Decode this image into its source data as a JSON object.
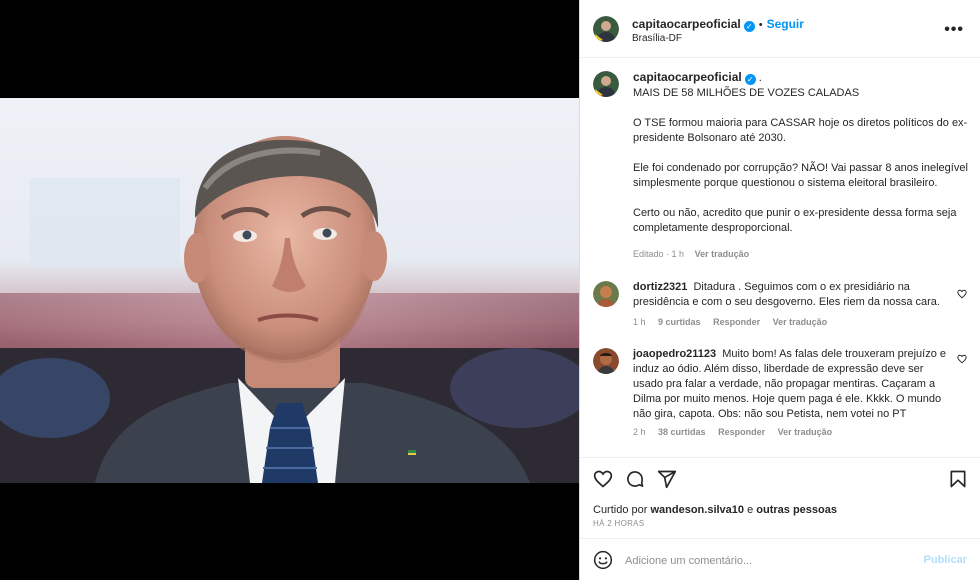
{
  "post": {
    "username": "capitaocarpeoficial",
    "follow_label": "Seguir",
    "separator": "•",
    "location": "Brasília-DF",
    "more_label": "•••"
  },
  "caption": {
    "username": "capitaocarpeoficial",
    "trail": ".",
    "paragraphs": [
      "MAIS DE 58 MILHÕES DE VOZES CALADAS",
      "O TSE formou maioria para CASSAR hoje os diretos políticos do ex-presidente Bolsonaro até 2030.",
      "Ele foi condenado por corrupção? NÃO! Vai passar 8 anos inelegível simplesmente porque questionou o sistema eleitoral brasileiro.",
      "Certo ou não, acredito que punir o ex-presidente dessa forma seja completamente desproporcional."
    ],
    "edited": "Editado · 1 h",
    "translate": "Ver tradução"
  },
  "comments": [
    {
      "username": "dortiz2321",
      "text": "Ditadura . Seguimos com o ex presidiário na presidência e com o seu desgoverno. Eles riem da nossa cara.",
      "time": "1 h",
      "likes": "9 curtidas",
      "reply": "Responder",
      "translate": "Ver tradução"
    },
    {
      "username": "joaopedro21123",
      "text": "Muito bom! As falas dele trouxeram prejuízo e induz ao ódio. Além disso, liberdade de expressão deve ser usado pra falar a verdade, não propagar mentiras. Caçaram a Dilma por muito menos. Hoje quem paga é ele. Kkkk. O mundo não gira, capota. Obs: não sou Petista, nem votei no PT",
      "time": "2 h",
      "likes": "38 curtidas",
      "reply": "Responder",
      "translate": "Ver tradução"
    }
  ],
  "likes": {
    "prefix": "Curtido por",
    "user": "wandeson.silva10",
    "middle": "e",
    "others": "outras pessoas"
  },
  "timestamp": "HÁ 2 HORAS",
  "add_comment": {
    "placeholder": "Adicione um comentário...",
    "publish_label": "Publicar"
  },
  "icons": {
    "like": "heart-icon",
    "comment": "comment-icon",
    "share": "share-icon",
    "save": "bookmark-icon",
    "emoji": "emoji-icon",
    "verified": "verified-badge-icon"
  },
  "colors": {
    "accent": "#0095f6",
    "muted": "#8e8e8e",
    "publish_disabled": "#b2dffc"
  }
}
